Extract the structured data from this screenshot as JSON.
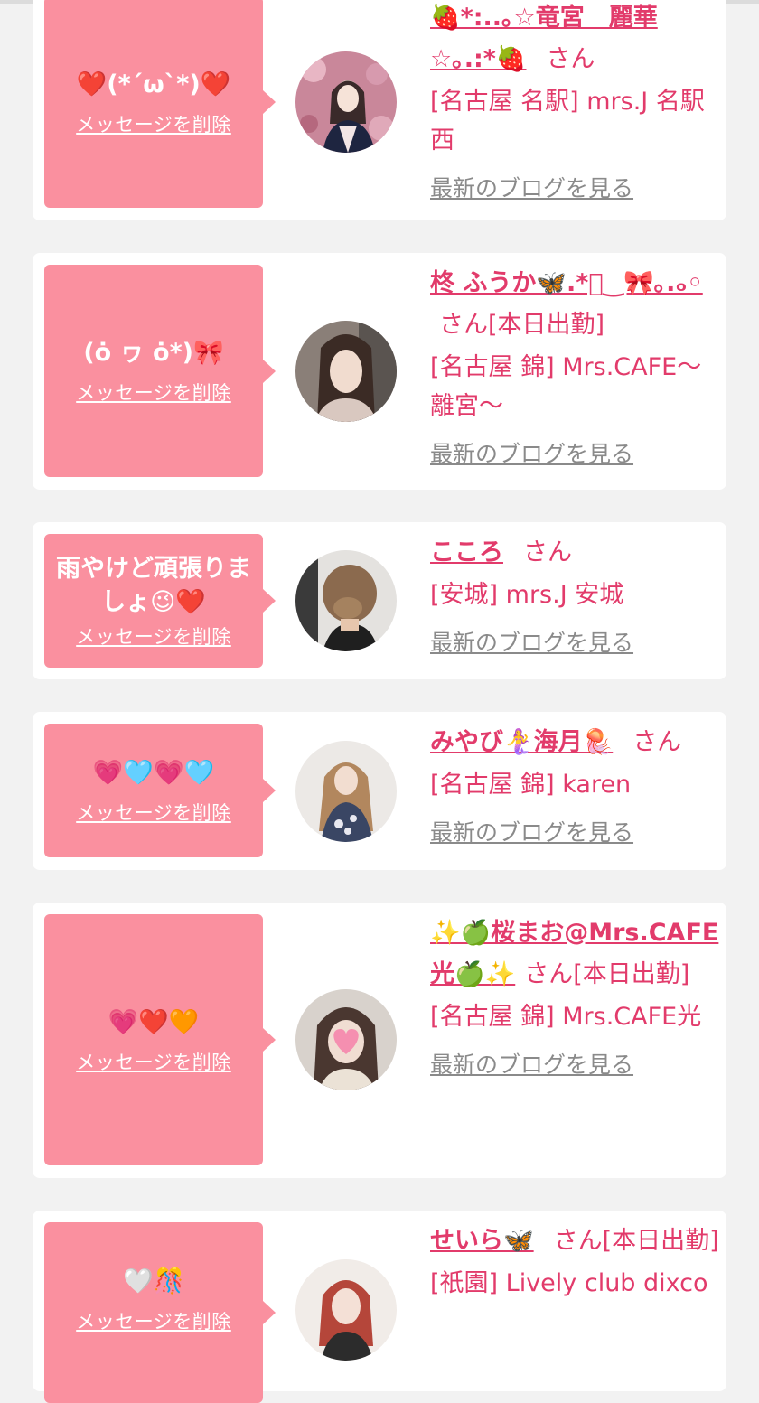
{
  "delete_label": "メッセージを削除",
  "blog_label": "最新のブログを見る",
  "cards": [
    {
      "message": "❤️(*´ω`*)❤️",
      "name": "🍓*:..｡☆竜宮　麗華☆｡.:*🍓",
      "suffix": "さん",
      "shop": "[名古屋 名駅] mrs.J 名駅西"
    },
    {
      "message": "(ȯ ヮ ȯ*)🎀",
      "name": "柊 ふうか🦋.*ﾟ‿🎀｡.ₒ◦",
      "suffix": "さん[本日出勤]",
      "shop": "[名古屋 錦] Mrs.CAFE〜離宮〜"
    },
    {
      "message": "雨やけど頑張りましょ😉❤️",
      "name": "こころ",
      "suffix": "さん",
      "shop": "[安城] mrs.J 安城"
    },
    {
      "message": "💗🩵💗🩵",
      "name": "みやび🧜‍♀️海月🪼",
      "suffix": "さん",
      "shop": "[名古屋 錦] karen"
    },
    {
      "message": "💗❤️🧡",
      "name": "✨🍏桜まお@Mrs.CAFE光🍏✨",
      "suffix": "さん[本日出勤]",
      "shop": "[名古屋 錦] Mrs.CAFE光"
    },
    {
      "message": "🤍🎊",
      "name": "せいら🦋",
      "suffix": "さん[本日出勤]",
      "shop": "[祇園] Lively club dixco"
    }
  ],
  "colors": {
    "background": "#f2f2f2",
    "bubble": "#fa909f",
    "accent_text": "#e23b6b",
    "link_gray": "#8a8a8a"
  }
}
